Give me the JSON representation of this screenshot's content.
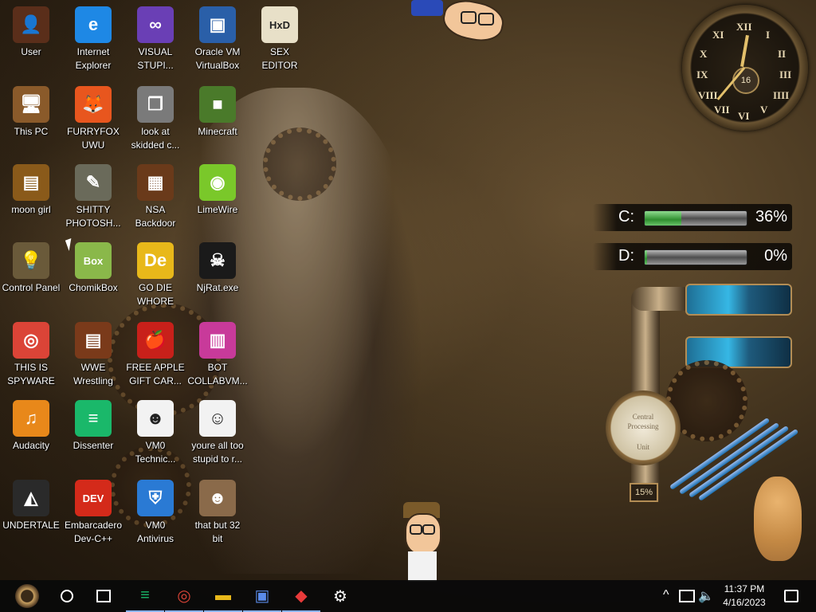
{
  "desktop": {
    "icons": [
      {
        "id": "user",
        "label": "User",
        "glyph": "👤",
        "bg": "#5a2e1a"
      },
      {
        "id": "internet-explorer",
        "label": "Internet\nExplorer",
        "glyph": "e",
        "bg": "#1e88e5"
      },
      {
        "id": "visual-studio",
        "label": "VISUAL\nSTUPI...",
        "glyph": "∞",
        "bg": "#6a3fb5"
      },
      {
        "id": "virtualbox",
        "label": "Oracle VM\nVirtualBox",
        "glyph": "▣",
        "bg": "#2a5fa8"
      },
      {
        "id": "sex-editor",
        "label": "SEX\nEDITOR",
        "glyph": "HxD",
        "bg": "#e8e0c8"
      },
      {
        "id": "this-pc",
        "label": "This PC",
        "glyph": "🖥",
        "bg": "#8a5a2a"
      },
      {
        "id": "furryfox",
        "label": "FURRYFOX\nUWU",
        "glyph": "🦊",
        "bg": "#e8561e"
      },
      {
        "id": "skidded",
        "label": "look at\nskidded c...",
        "glyph": "❐",
        "bg": "#7a7a7a"
      },
      {
        "id": "minecraft",
        "label": "Minecraft",
        "glyph": "■",
        "bg": "#4a7a2a"
      },
      {
        "id": "moon-girl",
        "label": "moon girl",
        "glyph": "▤",
        "bg": "#8a5a1a"
      },
      {
        "id": "gimp",
        "label": "SHITTY\nPHOTOSH...",
        "glyph": "✎",
        "bg": "#6a6a5a"
      },
      {
        "id": "nsa-backdoor",
        "label": "NSA\nBackdoor",
        "glyph": "▦",
        "bg": "#6a3a1a"
      },
      {
        "id": "limewire",
        "label": "LimeWire",
        "glyph": "◉",
        "bg": "#7ac82a"
      },
      {
        "id": "control-panel",
        "label": "Control Panel",
        "glyph": "💡",
        "bg": "#6a5a3a"
      },
      {
        "id": "chomikbox",
        "label": "ChomikBox",
        "glyph": "Box",
        "bg": "#8ab84a"
      },
      {
        "id": "go-die",
        "label": "GO DIE\nWHORE",
        "glyph": "De",
        "bg": "#e8b81a"
      },
      {
        "id": "njrat",
        "label": "NjRat.exe",
        "glyph": "☠",
        "bg": "#1a1a1a"
      },
      {
        "id": "chrome",
        "label": "THIS IS\nSPYWARE",
        "glyph": "◎",
        "bg": "#db4437"
      },
      {
        "id": "wwe",
        "label": "WWE\nWrestling",
        "glyph": "▤",
        "bg": "#7a3a1a"
      },
      {
        "id": "free-apple",
        "label": "FREE APPLE\nGIFT CAR...",
        "glyph": "🍎",
        "bg": "#c8201a"
      },
      {
        "id": "bot-collab",
        "label": "BOT\nCOLLABVM...",
        "glyph": "▥",
        "bg": "#c83a9a"
      },
      {
        "id": "audacity",
        "label": "Audacity",
        "glyph": "♫",
        "bg": "#e8881a"
      },
      {
        "id": "dissenter",
        "label": "Dissenter",
        "glyph": "≡",
        "bg": "#1ab86a"
      },
      {
        "id": "vm0-tech",
        "label": "VM0\nTechnic...",
        "glyph": "☻",
        "bg": "#f2f2f2"
      },
      {
        "id": "too-stupid",
        "label": "youre all too\nstupid to r...",
        "glyph": "☺",
        "bg": "#f2f2f2"
      },
      {
        "id": "undertale",
        "label": "UNDERTALE",
        "glyph": "◭",
        "bg": "#2a2a2a"
      },
      {
        "id": "devcpp",
        "label": "Embarcadero\nDev-C++",
        "glyph": "DEV",
        "bg": "#d42a1a"
      },
      {
        "id": "vm0-antivirus",
        "label": "VM0\nAntivirus",
        "glyph": "⛨",
        "bg": "#2a7ad4"
      },
      {
        "id": "that-but-32",
        "label": "that but 32\nbit",
        "glyph": "☻",
        "bg": "#8a6a4a"
      }
    ]
  },
  "clock": {
    "numerals": [
      "XII",
      "I",
      "II",
      "III",
      "IIII",
      "V",
      "VI",
      "VII",
      "VIII",
      "IX",
      "X",
      "XI"
    ],
    "date_day": "16"
  },
  "drives": [
    {
      "letter": "C:",
      "percent": "36%",
      "fill": 0.36
    },
    {
      "letter": "D:",
      "percent": "0%",
      "fill": 0.0
    }
  ],
  "gauge": {
    "dial_top": "Central",
    "dial_mid": "Processing",
    "dial_bottom": "Unit",
    "percent": "15%"
  },
  "taskbar": {
    "start_icon": "steampunk-start-icon",
    "search_icon": "circle-icon",
    "task_view_icon": "task-view-icon",
    "pinned": [
      {
        "name": "dissenter-taskbar",
        "glyph": "≡",
        "color": "#1ab86a"
      },
      {
        "name": "chrome-taskbar",
        "glyph": "◎",
        "color": "#db4437"
      },
      {
        "name": "file-explorer-taskbar",
        "glyph": "▬",
        "color": "#e8b81a"
      },
      {
        "name": "vbox-taskbar",
        "glyph": "▣",
        "color": "#5a8ae8"
      },
      {
        "name": "anydesk-taskbar",
        "glyph": "◆",
        "color": "#e83a3a"
      },
      {
        "name": "settings-taskbar",
        "glyph": "⚙",
        "color": "#ffffff"
      }
    ],
    "tray_chevron": "^",
    "time": "11:37 PM",
    "date": "4/16/2023"
  }
}
